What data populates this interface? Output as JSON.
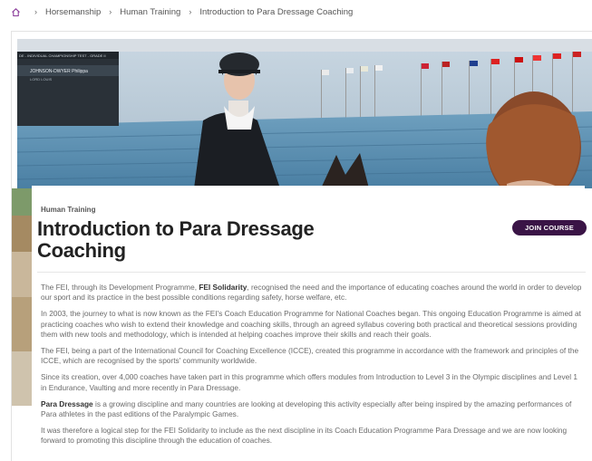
{
  "breadcrumb": {
    "items": [
      "Horsemanship",
      "Human Training",
      "Introduction to Para Dressage Coaching"
    ]
  },
  "hero": {
    "scoreboard_line1": "DE - INDIVIDUAL CHAMPIONSHIP TEST - GRADE II",
    "scoreboard_line2": "JOHNSON-DWYER Philippa",
    "scoreboard_line3": "LORD LOUIS"
  },
  "course": {
    "kicker": "Human Training",
    "title": "Introduction to Para Dressage Coaching",
    "join_label": "JOIN COURSE"
  },
  "body": {
    "p1_a": "The FEI, through its Development Programme, ",
    "p1_b": "FEI Solidarity",
    "p1_c": ", recognised the need and the importance of educating coaches around the world in order to develop our sport and its practice in the best possible conditions regarding safety, horse welfare, etc.",
    "p2": "In 2003, the journey to what is now known as the FEI's Coach Education Programme for National Coaches began. This ongoing Education Programme is aimed at practicing coaches who wish to extend their knowledge and coaching skills, through an agreed syllabus covering both practical and theoretical sessions providing them with new tools and methodology, which is intended at helping coaches improve their skills and reach their goals.",
    "p3": "The FEI, being a part of the International Council for Coaching Excellence (ICCE), created this programme in accordance with the framework and principles of the ICCE, which are recognised by the sports' community worldwide.",
    "p4": "Since its creation, over 4,000 coaches have taken part in this programme which offers modules from Introduction to Level 3 in the Olympic disciplines and Level 1 in Endurance, Vaulting and more recently in Para Dressage.",
    "p5_a": "Para Dressage",
    "p5_b": " is a growing discipline and many countries are looking at developing this activity especially after being inspired by the amazing performances of Para athletes in the past editions of the Paralympic Games.",
    "p6": "It was therefore a logical step for the FEI Solidarity to include as the next discipline in its Coach Education Programme Para Dressage and we are now looking forward to promoting this discipline through the education of coaches."
  },
  "colors": {
    "button_bg": "#3a1446",
    "body_text": "#6a6a6a",
    "home_icon": "#8a3b9a"
  }
}
